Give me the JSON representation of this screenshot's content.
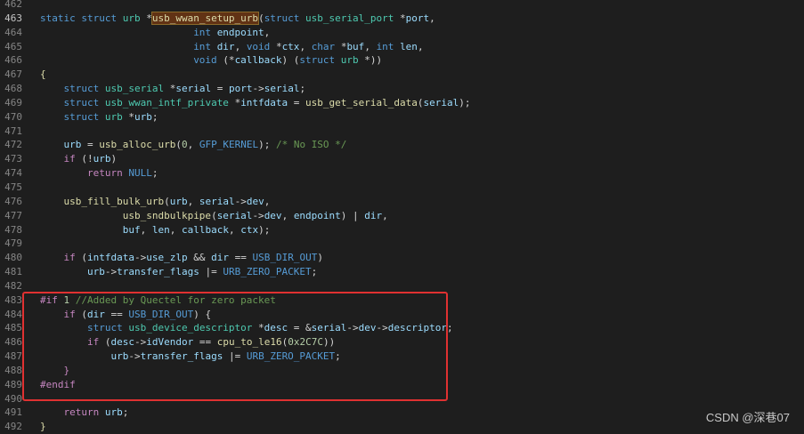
{
  "watermark": "CSDN @深巷07",
  "lines": [
    {
      "n": "462",
      "active": false,
      "tokens": []
    },
    {
      "n": "463",
      "active": true,
      "tokens": [
        {
          "t": "static ",
          "c": "kw"
        },
        {
          "t": "struct ",
          "c": "kw"
        },
        {
          "t": "urb ",
          "c": "ty"
        },
        {
          "t": "*",
          "c": ""
        },
        {
          "t": "usb_wwan_setup_urb",
          "c": "fn hl"
        },
        {
          "t": "(",
          "c": ""
        },
        {
          "t": "struct ",
          "c": "kw"
        },
        {
          "t": "usb_serial_port ",
          "c": "ty"
        },
        {
          "t": "*",
          "c": ""
        },
        {
          "t": "port",
          "c": "var"
        },
        {
          "t": ",",
          "c": ""
        }
      ]
    },
    {
      "n": "464",
      "active": false,
      "tokens": [
        {
          "t": "                          ",
          "c": ""
        },
        {
          "t": "int ",
          "c": "kw"
        },
        {
          "t": "endpoint",
          "c": "var"
        },
        {
          "t": ",",
          "c": ""
        }
      ]
    },
    {
      "n": "465",
      "active": false,
      "tokens": [
        {
          "t": "                          ",
          "c": ""
        },
        {
          "t": "int ",
          "c": "kw"
        },
        {
          "t": "dir",
          "c": "var"
        },
        {
          "t": ", ",
          "c": ""
        },
        {
          "t": "void ",
          "c": "kw"
        },
        {
          "t": "*",
          "c": ""
        },
        {
          "t": "ctx",
          "c": "var"
        },
        {
          "t": ", ",
          "c": ""
        },
        {
          "t": "char ",
          "c": "kw"
        },
        {
          "t": "*",
          "c": ""
        },
        {
          "t": "buf",
          "c": "var"
        },
        {
          "t": ", ",
          "c": ""
        },
        {
          "t": "int ",
          "c": "kw"
        },
        {
          "t": "len",
          "c": "var"
        },
        {
          "t": ",",
          "c": ""
        }
      ]
    },
    {
      "n": "466",
      "active": false,
      "tokens": [
        {
          "t": "                          ",
          "c": ""
        },
        {
          "t": "void ",
          "c": "kw"
        },
        {
          "t": "(*",
          "c": ""
        },
        {
          "t": "callback",
          "c": "var"
        },
        {
          "t": ") (",
          "c": ""
        },
        {
          "t": "struct ",
          "c": "kw"
        },
        {
          "t": "urb ",
          "c": "ty"
        },
        {
          "t": "*))",
          "c": ""
        }
      ]
    },
    {
      "n": "467",
      "active": false,
      "tokens": [
        {
          "t": "{",
          "c": "fn"
        }
      ]
    },
    {
      "n": "468",
      "active": false,
      "tokens": [
        {
          "t": "    ",
          "c": ""
        },
        {
          "t": "struct ",
          "c": "kw"
        },
        {
          "t": "usb_serial ",
          "c": "ty"
        },
        {
          "t": "*",
          "c": ""
        },
        {
          "t": "serial",
          "c": "var"
        },
        {
          "t": " = ",
          "c": ""
        },
        {
          "t": "port",
          "c": "var"
        },
        {
          "t": "->",
          "c": ""
        },
        {
          "t": "serial",
          "c": "var"
        },
        {
          "t": ";",
          "c": ""
        }
      ]
    },
    {
      "n": "469",
      "active": false,
      "tokens": [
        {
          "t": "    ",
          "c": ""
        },
        {
          "t": "struct ",
          "c": "kw"
        },
        {
          "t": "usb_wwan_intf_private ",
          "c": "ty"
        },
        {
          "t": "*",
          "c": ""
        },
        {
          "t": "intfdata",
          "c": "var"
        },
        {
          "t": " = ",
          "c": ""
        },
        {
          "t": "usb_get_serial_data",
          "c": "fn"
        },
        {
          "t": "(",
          "c": ""
        },
        {
          "t": "serial",
          "c": "var"
        },
        {
          "t": ");",
          "c": ""
        }
      ]
    },
    {
      "n": "470",
      "active": false,
      "tokens": [
        {
          "t": "    ",
          "c": ""
        },
        {
          "t": "struct ",
          "c": "kw"
        },
        {
          "t": "urb ",
          "c": "ty"
        },
        {
          "t": "*",
          "c": ""
        },
        {
          "t": "urb",
          "c": "var"
        },
        {
          "t": ";",
          "c": ""
        }
      ]
    },
    {
      "n": "471",
      "active": false,
      "tokens": []
    },
    {
      "n": "472",
      "active": false,
      "tokens": [
        {
          "t": "    ",
          "c": ""
        },
        {
          "t": "urb",
          "c": "var"
        },
        {
          "t": " = ",
          "c": ""
        },
        {
          "t": "usb_alloc_urb",
          "c": "fn"
        },
        {
          "t": "(",
          "c": ""
        },
        {
          "t": "0",
          "c": "num"
        },
        {
          "t": ", ",
          "c": ""
        },
        {
          "t": "GFP_KERNEL",
          "c": "mac"
        },
        {
          "t": "); ",
          "c": ""
        },
        {
          "t": "/* No ISO */",
          "c": "cm"
        }
      ]
    },
    {
      "n": "473",
      "active": false,
      "tokens": [
        {
          "t": "    ",
          "c": ""
        },
        {
          "t": "if ",
          "c": "pp"
        },
        {
          "t": "(!",
          "c": ""
        },
        {
          "t": "urb",
          "c": "var"
        },
        {
          "t": ")",
          "c": ""
        }
      ]
    },
    {
      "n": "474",
      "active": false,
      "tokens": [
        {
          "t": "        ",
          "c": ""
        },
        {
          "t": "return ",
          "c": "pp"
        },
        {
          "t": "NULL",
          "c": "mac"
        },
        {
          "t": ";",
          "c": ""
        }
      ]
    },
    {
      "n": "475",
      "active": false,
      "tokens": []
    },
    {
      "n": "476",
      "active": false,
      "tokens": [
        {
          "t": "    ",
          "c": ""
        },
        {
          "t": "usb_fill_bulk_urb",
          "c": "fn"
        },
        {
          "t": "(",
          "c": ""
        },
        {
          "t": "urb",
          "c": "var"
        },
        {
          "t": ", ",
          "c": ""
        },
        {
          "t": "serial",
          "c": "var"
        },
        {
          "t": "->",
          "c": ""
        },
        {
          "t": "dev",
          "c": "var"
        },
        {
          "t": ",",
          "c": ""
        }
      ]
    },
    {
      "n": "477",
      "active": false,
      "tokens": [
        {
          "t": "              ",
          "c": ""
        },
        {
          "t": "usb_sndbulkpipe",
          "c": "fn"
        },
        {
          "t": "(",
          "c": ""
        },
        {
          "t": "serial",
          "c": "var"
        },
        {
          "t": "->",
          "c": ""
        },
        {
          "t": "dev",
          "c": "var"
        },
        {
          "t": ", ",
          "c": ""
        },
        {
          "t": "endpoint",
          "c": "var"
        },
        {
          "t": ") | ",
          "c": ""
        },
        {
          "t": "dir",
          "c": "var"
        },
        {
          "t": ",",
          "c": ""
        }
      ]
    },
    {
      "n": "478",
      "active": false,
      "tokens": [
        {
          "t": "              ",
          "c": ""
        },
        {
          "t": "buf",
          "c": "var"
        },
        {
          "t": ", ",
          "c": ""
        },
        {
          "t": "len",
          "c": "var"
        },
        {
          "t": ", ",
          "c": ""
        },
        {
          "t": "callback",
          "c": "var"
        },
        {
          "t": ", ",
          "c": ""
        },
        {
          "t": "ctx",
          "c": "var"
        },
        {
          "t": ");",
          "c": ""
        }
      ]
    },
    {
      "n": "479",
      "active": false,
      "tokens": []
    },
    {
      "n": "480",
      "active": false,
      "tokens": [
        {
          "t": "    ",
          "c": ""
        },
        {
          "t": "if ",
          "c": "pp"
        },
        {
          "t": "(",
          "c": ""
        },
        {
          "t": "intfdata",
          "c": "var"
        },
        {
          "t": "->",
          "c": ""
        },
        {
          "t": "use_zlp",
          "c": "var"
        },
        {
          "t": " && ",
          "c": ""
        },
        {
          "t": "dir",
          "c": "var"
        },
        {
          "t": " == ",
          "c": ""
        },
        {
          "t": "USB_DIR_OUT",
          "c": "mac"
        },
        {
          "t": ")",
          "c": ""
        }
      ]
    },
    {
      "n": "481",
      "active": false,
      "tokens": [
        {
          "t": "        ",
          "c": ""
        },
        {
          "t": "urb",
          "c": "var"
        },
        {
          "t": "->",
          "c": ""
        },
        {
          "t": "transfer_flags",
          "c": "var"
        },
        {
          "t": " |= ",
          "c": ""
        },
        {
          "t": "URB_ZERO_PACKET",
          "c": "mac"
        },
        {
          "t": ";",
          "c": ""
        }
      ]
    },
    {
      "n": "482",
      "active": false,
      "tokens": []
    },
    {
      "n": "483",
      "active": false,
      "tokens": [
        {
          "t": "#if ",
          "c": "pp"
        },
        {
          "t": "1 ",
          "c": "num"
        },
        {
          "t": "//Added by Quectel for zero packet",
          "c": "cm"
        }
      ]
    },
    {
      "n": "484",
      "active": false,
      "tokens": [
        {
          "t": "    ",
          "c": ""
        },
        {
          "t": "if ",
          "c": "pp"
        },
        {
          "t": "(",
          "c": ""
        },
        {
          "t": "dir",
          "c": "var"
        },
        {
          "t": " == ",
          "c": ""
        },
        {
          "t": "USB_DIR_OUT",
          "c": "mac"
        },
        {
          "t": ") {",
          "c": ""
        }
      ]
    },
    {
      "n": "485",
      "active": false,
      "tokens": [
        {
          "t": "        ",
          "c": ""
        },
        {
          "t": "struct ",
          "c": "kw"
        },
        {
          "t": "usb_device_descriptor ",
          "c": "ty"
        },
        {
          "t": "*",
          "c": ""
        },
        {
          "t": "desc",
          "c": "var"
        },
        {
          "t": " = &",
          "c": ""
        },
        {
          "t": "serial",
          "c": "var"
        },
        {
          "t": "->",
          "c": ""
        },
        {
          "t": "dev",
          "c": "var"
        },
        {
          "t": "->",
          "c": ""
        },
        {
          "t": "descriptor",
          "c": "var"
        },
        {
          "t": ";",
          "c": ""
        }
      ]
    },
    {
      "n": "486",
      "active": false,
      "tokens": [
        {
          "t": "        ",
          "c": ""
        },
        {
          "t": "if ",
          "c": "pp"
        },
        {
          "t": "(",
          "c": ""
        },
        {
          "t": "desc",
          "c": "var"
        },
        {
          "t": "->",
          "c": ""
        },
        {
          "t": "idVendor",
          "c": "var"
        },
        {
          "t": " == ",
          "c": ""
        },
        {
          "t": "cpu_to_le16",
          "c": "fn"
        },
        {
          "t": "(",
          "c": ""
        },
        {
          "t": "0x2C7C",
          "c": "num"
        },
        {
          "t": "))",
          "c": ""
        }
      ]
    },
    {
      "n": "487",
      "active": false,
      "tokens": [
        {
          "t": "            ",
          "c": ""
        },
        {
          "t": "urb",
          "c": "var"
        },
        {
          "t": "->",
          "c": ""
        },
        {
          "t": "transfer_flags",
          "c": "var"
        },
        {
          "t": " |= ",
          "c": ""
        },
        {
          "t": "URB_ZERO_PACKET",
          "c": "mac"
        },
        {
          "t": ";",
          "c": ""
        }
      ]
    },
    {
      "n": "488",
      "active": false,
      "tokens": [
        {
          "t": "    ",
          "c": ""
        },
        {
          "t": "}",
          "c": "pp"
        }
      ]
    },
    {
      "n": "489",
      "active": false,
      "tokens": [
        {
          "t": "#endif",
          "c": "pp"
        }
      ]
    },
    {
      "n": "490",
      "active": false,
      "tokens": []
    },
    {
      "n": "491",
      "active": false,
      "tokens": [
        {
          "t": "    ",
          "c": ""
        },
        {
          "t": "return ",
          "c": "pp"
        },
        {
          "t": "urb",
          "c": "var"
        },
        {
          "t": ";",
          "c": ""
        }
      ]
    },
    {
      "n": "492",
      "active": false,
      "tokens": [
        {
          "t": "}",
          "c": "fn"
        }
      ]
    }
  ]
}
